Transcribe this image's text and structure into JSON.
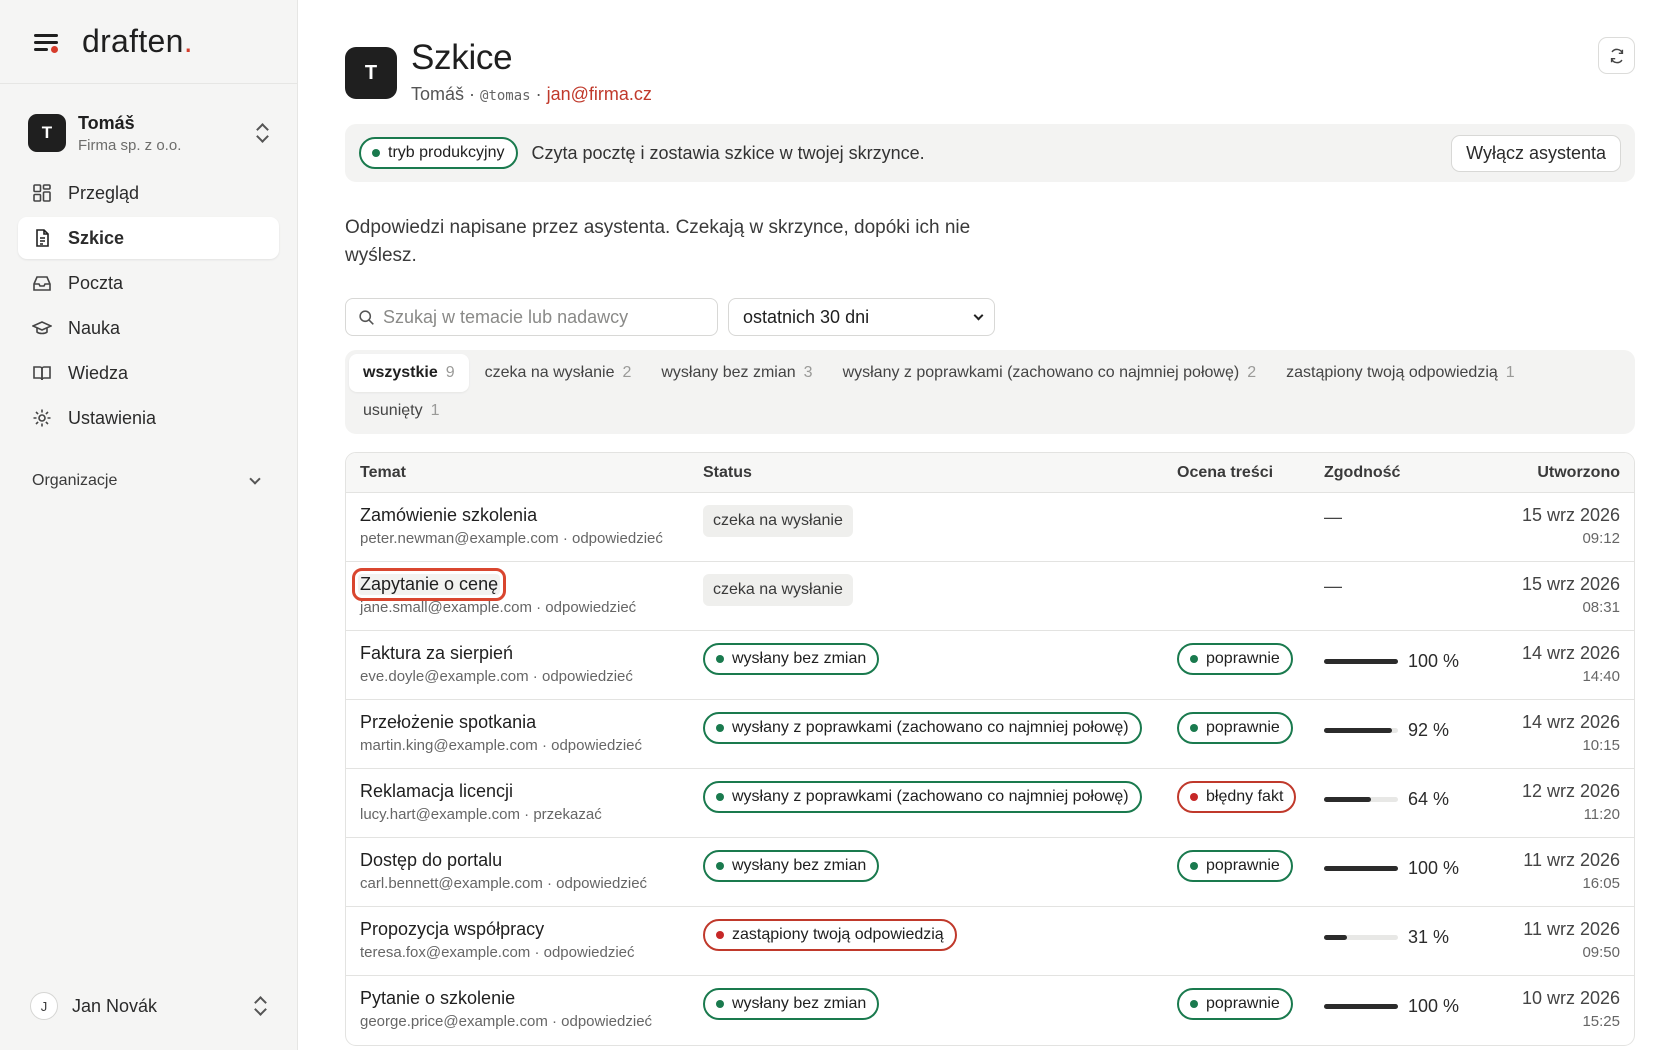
{
  "sidebar": {
    "brand": "draften",
    "brand_dot": ".",
    "account": {
      "initial": "T",
      "name": "Tomáš",
      "org": "Firma sp. z o.o."
    },
    "nav": [
      {
        "label": "Przegląd",
        "icon": "dashboard-icon"
      },
      {
        "label": "Szkice",
        "icon": "document-icon",
        "active": true
      },
      {
        "label": "Poczta",
        "icon": "inbox-icon"
      },
      {
        "label": "Nauka",
        "icon": "graduation-cap-icon"
      },
      {
        "label": "Wiedza",
        "icon": "book-icon"
      },
      {
        "label": "Ustawienia",
        "icon": "gear-icon"
      }
    ],
    "section": "Organizacje",
    "user": {
      "initial": "J",
      "name": "Jan Novák"
    }
  },
  "header": {
    "initial": "T",
    "title": "Szkice",
    "user": "Tomáš",
    "sep1": " · ",
    "handle": "@tomas",
    "sep2": " · ",
    "email": "jan@firma.cz"
  },
  "banner": {
    "mode": "tryb produkcyjny",
    "text": "Czyta pocztę i zostawia szkice w twojej skrzynce.",
    "button": "Wyłącz asystenta"
  },
  "intro": "Odpowiedzi napisane przez asystenta. Czekają w skrzynce, dopóki ich nie wyślesz.",
  "filters": {
    "search_placeholder": "Szukaj w temacie lub nadawcy",
    "range": "ostatnich 30 dni"
  },
  "tabs": [
    {
      "label": "wszystkie",
      "count": "9",
      "active": true
    },
    {
      "label": "czeka na wysłanie",
      "count": "2"
    },
    {
      "label": "wysłany bez zmian",
      "count": "3"
    },
    {
      "label": "wysłany z poprawkami (zachowano co najmniej połowę)",
      "count": "2"
    },
    {
      "label": "zastąpiony twoją odpowiedzią",
      "count": "1"
    },
    {
      "label": "usunięty",
      "count": "1"
    }
  ],
  "table": {
    "headers": [
      "Temat",
      "Status",
      "Ocena treści",
      "Zgodność",
      "Utworzono"
    ],
    "rows": [
      {
        "subject": "Zamówienie szkolenia",
        "sender": "peter.newman@example.com · odpowiedzieć",
        "status": "czeka na wysłanie",
        "status_kind": "gray",
        "rating": "",
        "rating_kind": "",
        "match": null,
        "match_text": "—",
        "date": "15 wrz 2026",
        "time": "09:12"
      },
      {
        "subject": "Zapytanie o cenę",
        "sender": "jane.small@example.com · odpowiedzieć",
        "status": "czeka na wysłanie",
        "status_kind": "gray",
        "rating": "",
        "rating_kind": "",
        "match": null,
        "match_text": "—",
        "date": "15 wrz 2026",
        "time": "08:31",
        "focused": true
      },
      {
        "subject": "Faktura za sierpień",
        "sender": "eve.doyle@example.com · odpowiedzieć",
        "status": "wysłany bez zmian",
        "status_kind": "green",
        "rating": "poprawnie",
        "rating_kind": "green",
        "match": 100,
        "match_text": "100 %",
        "date": "14 wrz 2026",
        "time": "14:40"
      },
      {
        "subject": "Przełożenie spotkania",
        "sender": "martin.king@example.com · odpowiedzieć",
        "status": "wysłany z poprawkami (zachowano co najmniej połowę)",
        "status_kind": "green",
        "rating": "poprawnie",
        "rating_kind": "green",
        "match": 92,
        "match_text": "92 %",
        "date": "14 wrz 2026",
        "time": "10:15"
      },
      {
        "subject": "Reklamacja licencji",
        "sender": "lucy.hart@example.com · przekazać",
        "status": "wysłany z poprawkami (zachowano co najmniej połowę)",
        "status_kind": "green",
        "rating": "błędny fakt",
        "rating_kind": "red",
        "match": 64,
        "match_text": "64 %",
        "date": "12 wrz 2026",
        "time": "11:20"
      },
      {
        "subject": "Dostęp do portalu",
        "sender": "carl.bennett@example.com · odpowiedzieć",
        "status": "wysłany bez zmian",
        "status_kind": "green",
        "rating": "poprawnie",
        "rating_kind": "green",
        "match": 100,
        "match_text": "100 %",
        "date": "11 wrz 2026",
        "time": "16:05"
      },
      {
        "subject": "Propozycja współpracy",
        "sender": "teresa.fox@example.com · odpowiedzieć",
        "status": "zastąpiony twoją odpowiedzią",
        "status_kind": "red",
        "rating": "",
        "rating_kind": "",
        "match": 31,
        "match_text": "31 %",
        "date": "11 wrz 2026",
        "time": "09:50"
      },
      {
        "subject": "Pytanie o szkolenie",
        "sender": "george.price@example.com · odpowiedzieć",
        "status": "wysłany bez zmian",
        "status_kind": "green",
        "rating": "poprawnie",
        "rating_kind": "green",
        "match": 100,
        "match_text": "100 %",
        "date": "10 wrz 2026",
        "time": "15:25"
      }
    ]
  },
  "colors": {
    "accent_red": "#d63c2b",
    "status_green": "#1a7a4e",
    "status_red": "#c62828"
  }
}
